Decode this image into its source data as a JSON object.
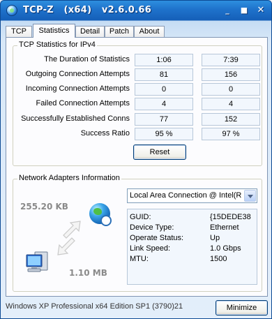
{
  "window": {
    "title": "TCP-Z   (x64)   v2.6.0.66",
    "minimize_glyph": "_",
    "maximize_glyph": "■",
    "close_glyph": "✕"
  },
  "tabs": [
    {
      "label": "TCP",
      "active": false
    },
    {
      "label": "Statistics",
      "active": true
    },
    {
      "label": "Detail",
      "active": false
    },
    {
      "label": "Patch",
      "active": false
    },
    {
      "label": "About",
      "active": false
    }
  ],
  "tcp_stats": {
    "group_title": "TCP Statistics for IPv4",
    "rows": [
      {
        "label": "The Duration of Statistics",
        "v1": "1:06",
        "v2": "7:39"
      },
      {
        "label": "Outgoing Connection Attempts",
        "v1": "81",
        "v2": "156"
      },
      {
        "label": "Incoming Connection Attempts",
        "v1": "0",
        "v2": "0"
      },
      {
        "label": "Failed Connection Attempts",
        "v1": "4",
        "v2": "4"
      },
      {
        "label": "Successfully Established Conns",
        "v1": "77",
        "v2": "152"
      },
      {
        "label": "Success Ratio",
        "v1": "95 %",
        "v2": "97 %"
      }
    ],
    "reset_label": "Reset"
  },
  "network": {
    "group_title": "Network Adapters Information",
    "bytes_received": "255.20 KB",
    "bytes_sent": "1.10 MB",
    "selected_adapter": "Local Area Connection @ Intel(R",
    "info": [
      {
        "key": "GUID:",
        "value": "{15DEDE38"
      },
      {
        "key": "Device Type:",
        "value": "Ethernet"
      },
      {
        "key": "Operate Status:",
        "value": "Up"
      },
      {
        "key": "Link Speed:",
        "value": "1.0 Gbps"
      },
      {
        "key": "MTU:",
        "value": "1500"
      }
    ],
    "icons": [
      "globe-icon",
      "transfer-arrows-icon",
      "computer-icon"
    ]
  },
  "footer": {
    "status": "Windows XP Professional x64 Edition SP1 (3790)21",
    "minimize_label": "Minimize"
  },
  "colors": {
    "titlebar": "#1f73cc",
    "panel_bg": "#fcfcfe",
    "value_bg": "#f2f7fd",
    "bytes_text": "#8a8a8a"
  }
}
